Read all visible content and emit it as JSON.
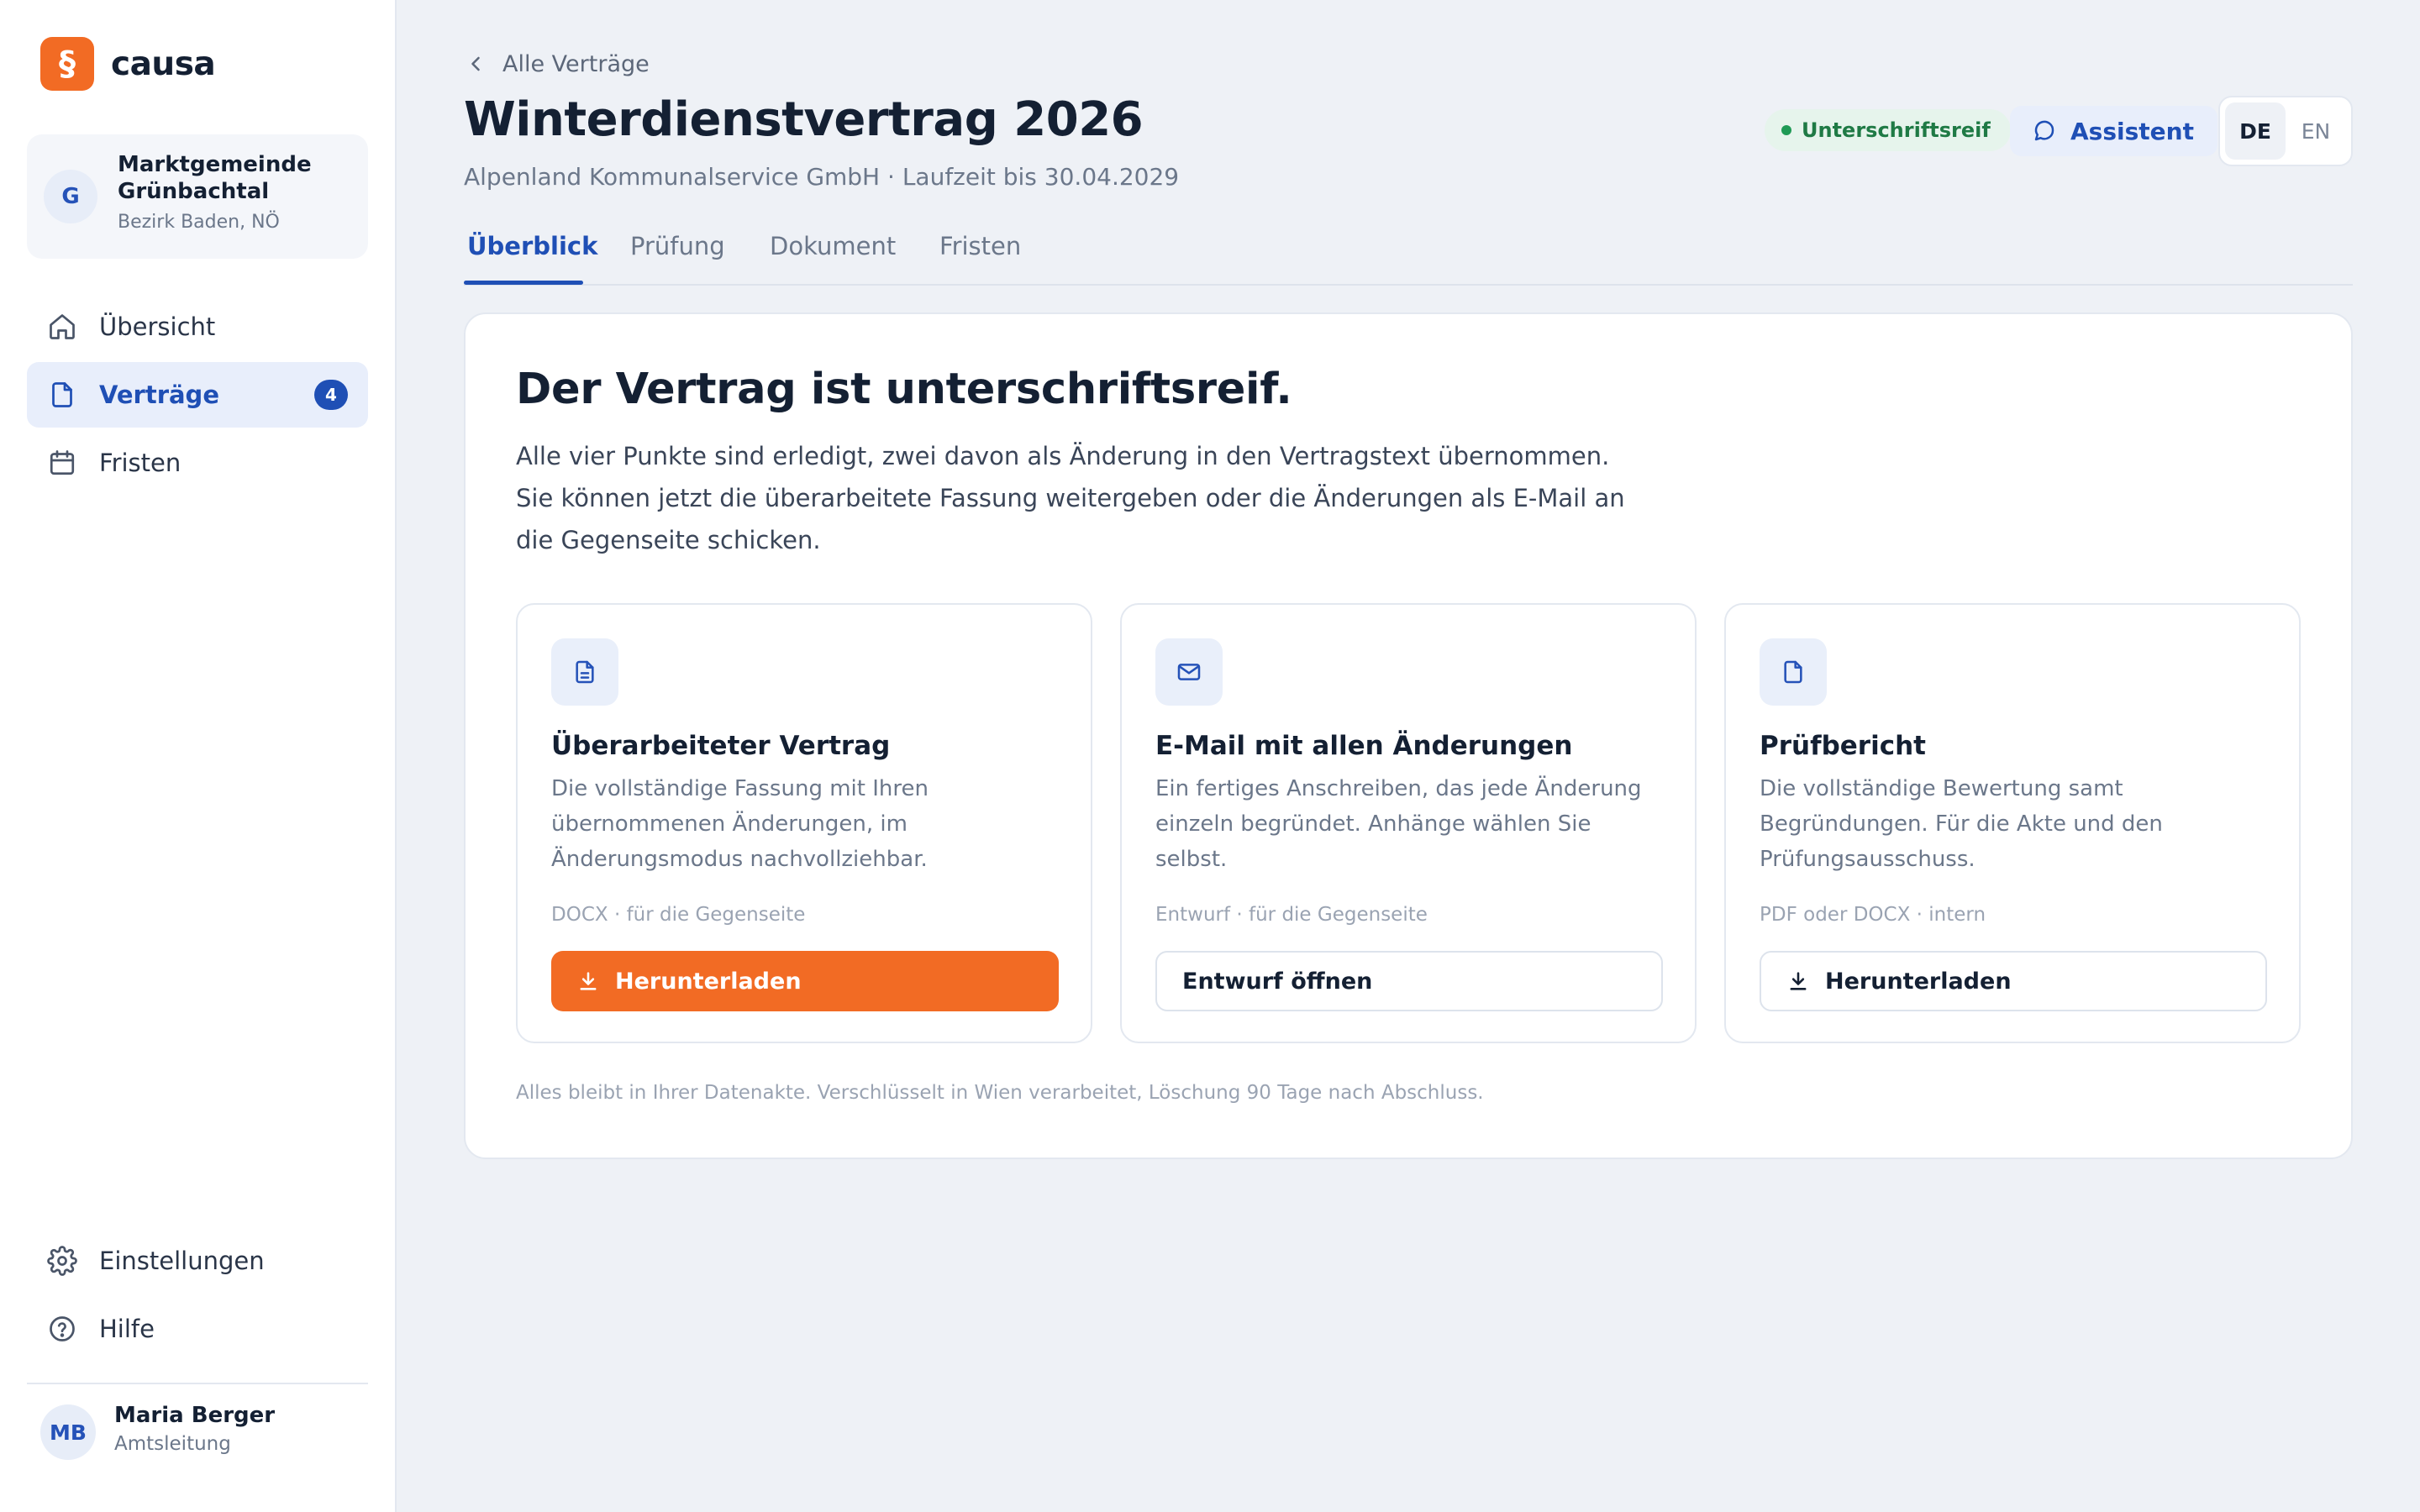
{
  "brand": {
    "logo_glyph": "§",
    "name": "causa",
    "color": "#f26b24"
  },
  "organization": {
    "avatar_initial": "G",
    "name": "Marktgemeinde Grünbachtal",
    "region": "Bezirk Baden, NÖ"
  },
  "nav": {
    "items": [
      {
        "label": "Übersicht",
        "icon": "home-icon"
      },
      {
        "label": "Verträge",
        "icon": "document-icon",
        "badge": "4",
        "active": true
      },
      {
        "label": "Fristen",
        "icon": "calendar-icon"
      }
    ],
    "bottom_items": [
      {
        "label": "Einstellungen",
        "icon": "gear-icon"
      },
      {
        "label": "Hilfe",
        "icon": "help-icon"
      }
    ]
  },
  "user": {
    "initials": "MB",
    "name": "Maria Berger",
    "role": "Amtsleitung"
  },
  "header": {
    "back_label": "Alle Verträge",
    "title": "Winterdienstvertrag 2026",
    "subtitle": "Alpenland Kommunalservice GmbH · Laufzeit bis 30.04.2029",
    "status": "Unterschriftsreif",
    "assistant_label": "Assistent",
    "languages": [
      "DE",
      "EN"
    ],
    "selected_language": "DE"
  },
  "tabs": [
    {
      "label": "Überblick",
      "active": true
    },
    {
      "label": "Prüfung"
    },
    {
      "label": "Dokument"
    },
    {
      "label": "Fristen"
    }
  ],
  "panel": {
    "title": "Der Vertrag ist unterschriftsreif.",
    "text": "Alle vier Punkte sind erledigt, zwei davon als Änderung in den Vertragstext übernommen. Sie können jetzt die überarbeitete Fassung weitergeben oder die Änderungen als E-Mail an die Gegenseite schicken.",
    "cards": [
      {
        "icon": "document-text-icon",
        "title": "Überarbeiteter Vertrag",
        "description": "Die vollständige Fassung mit Ihren übernommenen Änderungen, im Änderungsmodus nachvollziehbar.",
        "meta": "DOCX · für die Gegenseite",
        "button_label": "Herunterladen",
        "button_style": "primary"
      },
      {
        "icon": "mail-icon",
        "title": "E-Mail mit allen Änderungen",
        "description": "Ein fertiges Anschreiben, das jede Änderung einzeln begründet. Anhänge wählen Sie selbst.",
        "meta": "Entwurf · für die Gegenseite",
        "button_label": "Entwurf öffnen",
        "button_style": "secondary"
      },
      {
        "icon": "file-icon",
        "title": "Prüfbericht",
        "description": "Die vollständige Bewertung samt Begründungen. Für die Akte und den Prüfungsausschuss.",
        "meta": "PDF oder DOCX · intern",
        "button_label": "Herunterladen",
        "button_style": "secondary"
      }
    ],
    "footnote": "Alles bleibt in Ihrer Datenakte. Verschlüsselt in Wien verarbeitet, Löschung 90 Tage nach Abschluss."
  }
}
